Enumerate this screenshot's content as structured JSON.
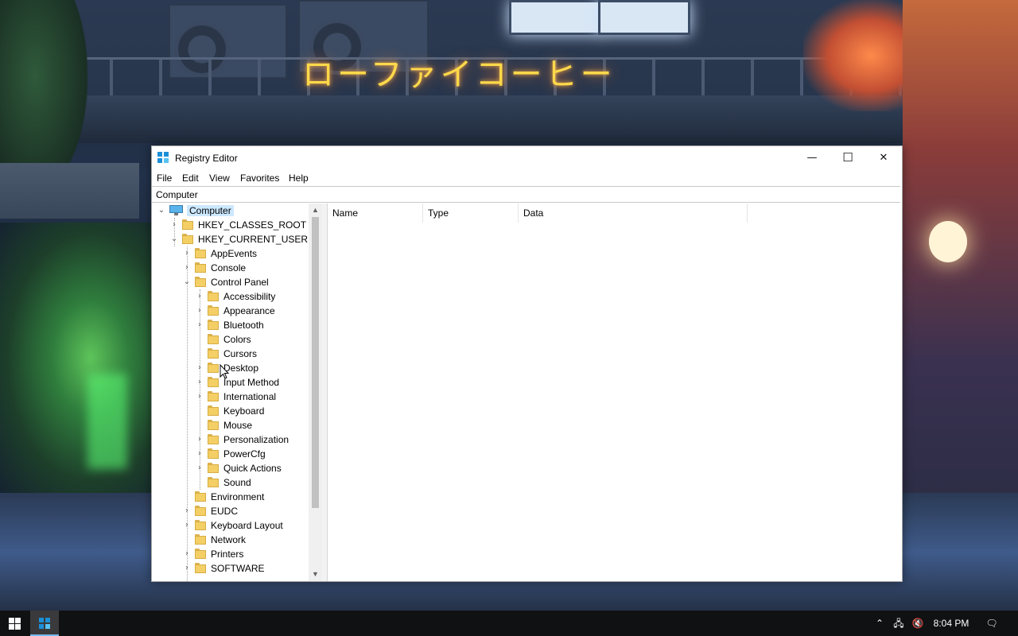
{
  "wallpaper": {
    "sign_text": "ローファイコーヒー"
  },
  "window": {
    "title": "Registry Editor",
    "controls": {
      "minimize": "—",
      "maximize": "☐",
      "close": "✕"
    }
  },
  "menu": [
    "File",
    "Edit",
    "View",
    "Favorites",
    "Help"
  ],
  "address": "Computer",
  "tree": {
    "root": "Computer",
    "hkcr": "HKEY_CLASSES_ROOT",
    "hkcu": "HKEY_CURRENT_USER",
    "hkcu_children": [
      "AppEvents",
      "Console",
      "Control Panel"
    ],
    "control_panel_children": [
      "Accessibility",
      "Appearance",
      "Bluetooth",
      "Colors",
      "Cursors",
      "Desktop",
      "Input Method",
      "International",
      "Keyboard",
      "Mouse",
      "Personalization",
      "PowerCfg",
      "Quick Actions",
      "Sound"
    ],
    "after_children": [
      "Environment",
      "EUDC",
      "Keyboard Layout",
      "Network",
      "Printers",
      "SOFTWARE"
    ]
  },
  "columns": [
    "Name",
    "Type",
    "Data"
  ],
  "taskbar": {
    "clock": "8:04 PM"
  },
  "colors": {
    "selection": "#cce8ff",
    "taskbar": "#101113",
    "accent": "#76b9ed"
  }
}
